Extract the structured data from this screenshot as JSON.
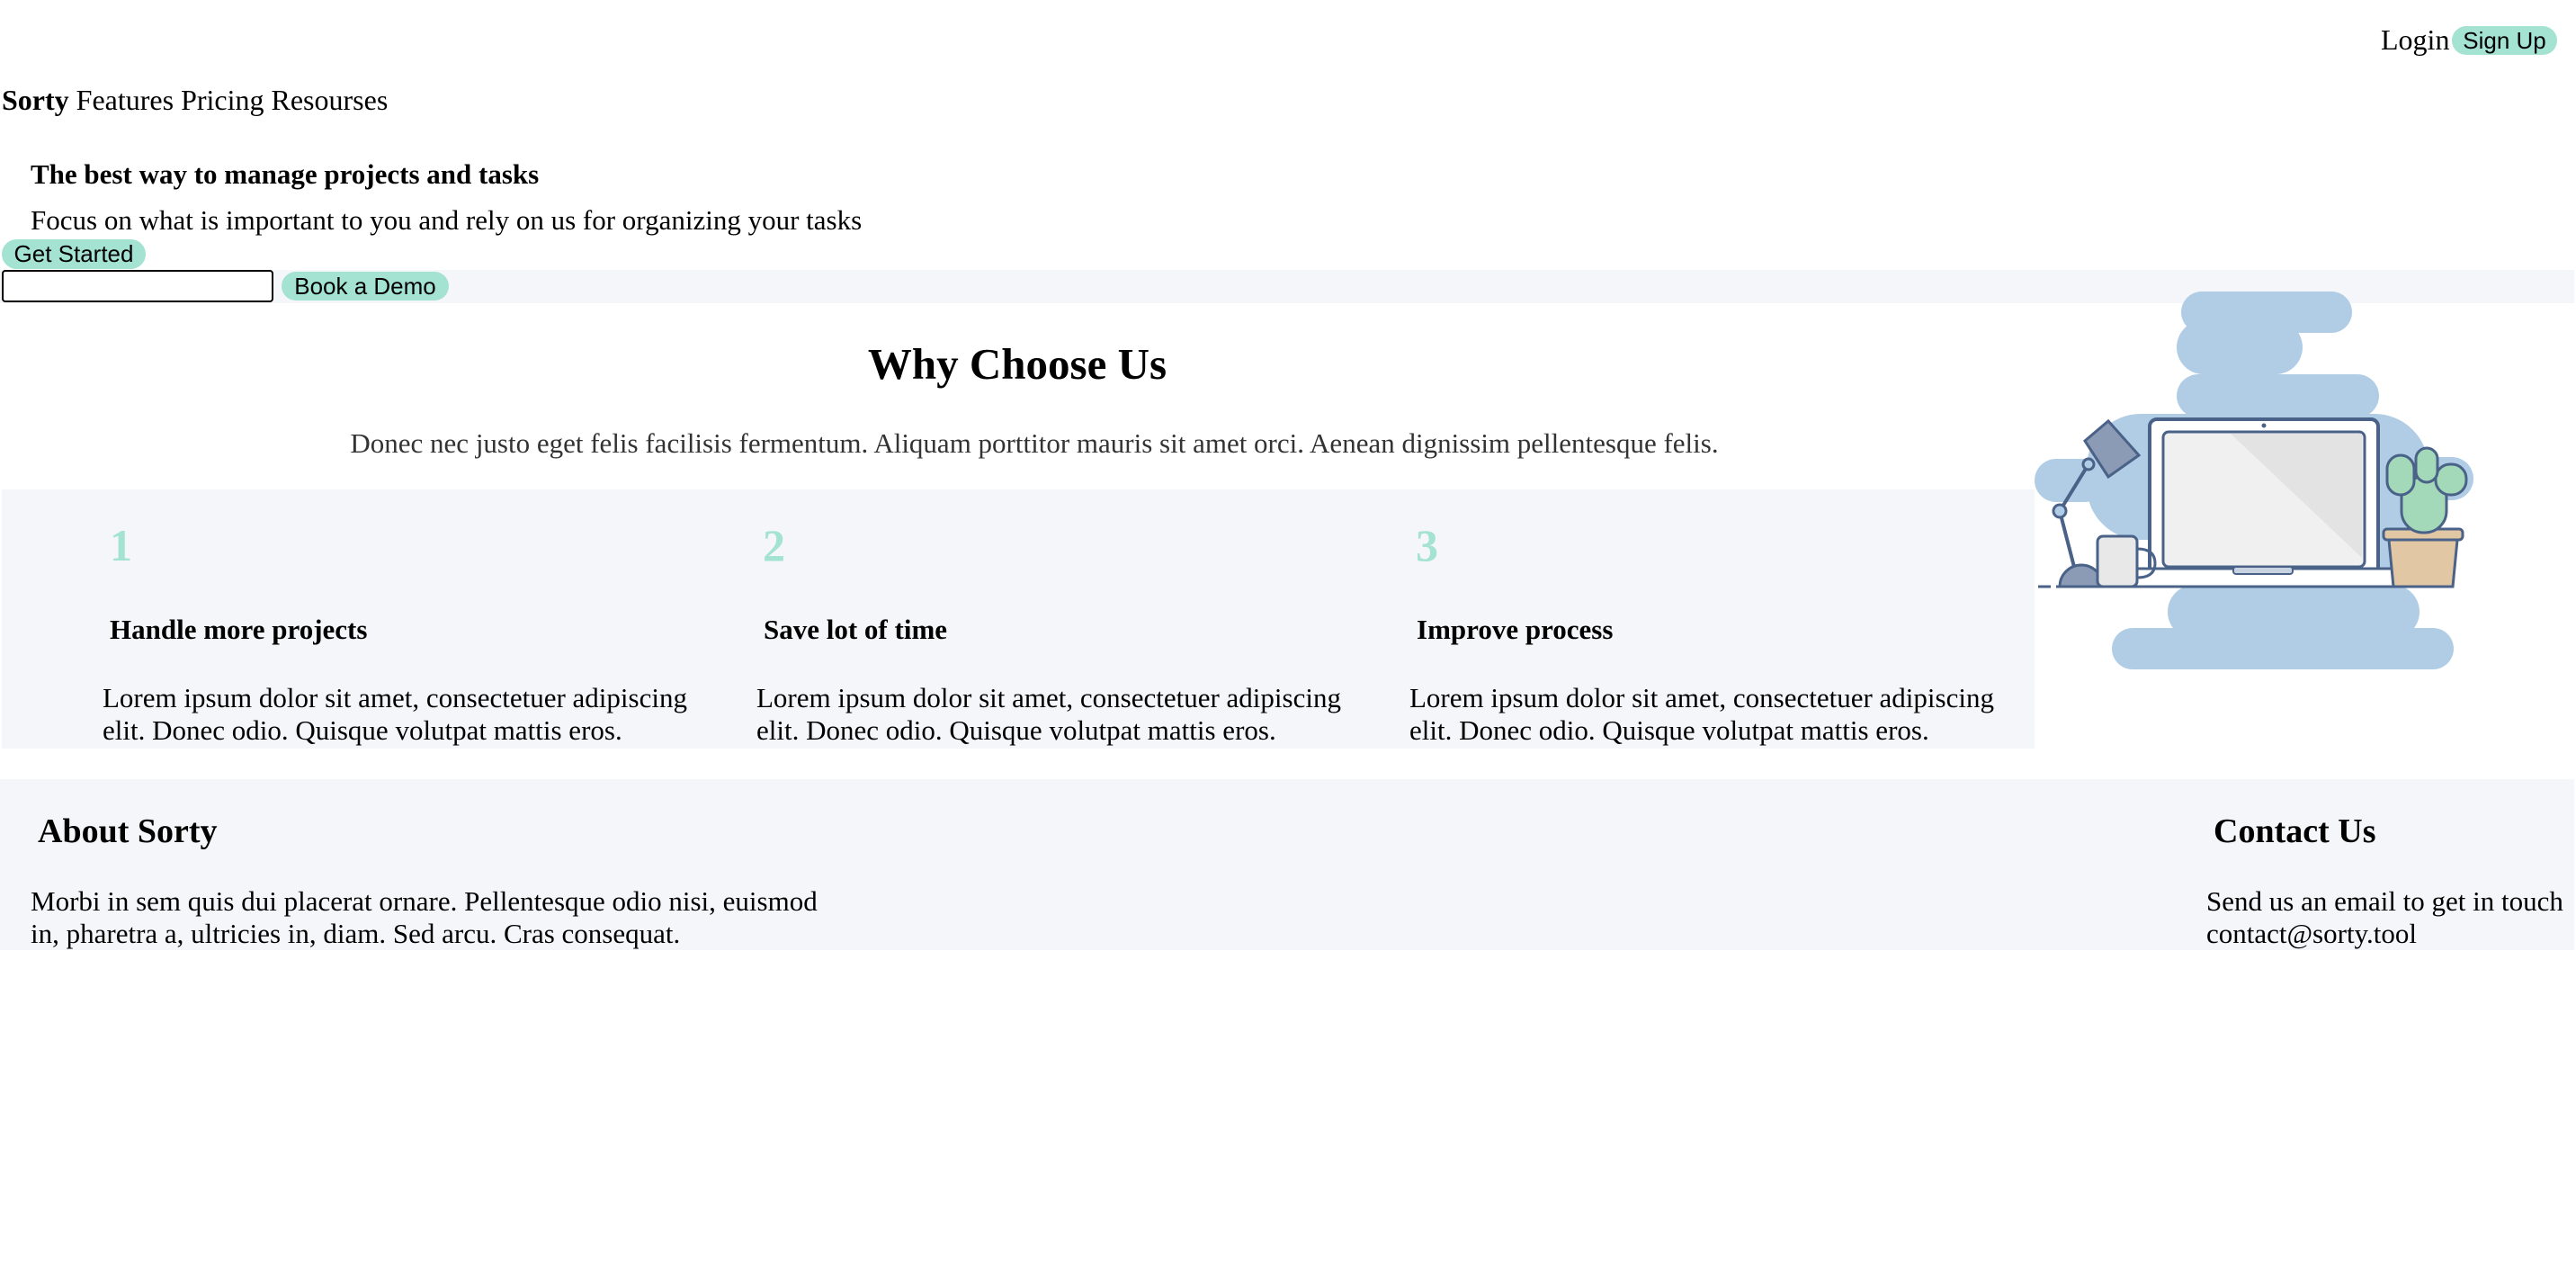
{
  "header": {
    "login_label": "Login",
    "signup_label": "Sign Up"
  },
  "nav": {
    "brand": "Sorty",
    "items": [
      "Features",
      "Pricing",
      "Resourses"
    ]
  },
  "hero": {
    "title": "The best way to manage projects and tasks",
    "subtitle": "Focus on what is important to you and rely on us for organizing your tasks",
    "get_started_label": "Get Started",
    "email_value": "",
    "book_demo_label": "Book a Demo"
  },
  "why": {
    "title": "Why Choose Us",
    "description": "Donec nec justo eget felis facilisis fermentum. Aliquam porttitor mauris sit amet orci. Aenean dignissim pellentesque felis.",
    "features": [
      {
        "number": "1",
        "title": "Handle more projects",
        "text": "Lorem ipsum dolor sit amet, consectetuer adipiscing elit. Donec odio. Quisque volutpat mattis eros."
      },
      {
        "number": "2",
        "title": "Save lot of time",
        "text": "Lorem ipsum dolor sit amet, consectetuer adipiscing elit. Donec odio. Quisque volutpat mattis eros."
      },
      {
        "number": "3",
        "title": "Improve process",
        "text": "Lorem ipsum dolor sit amet, consectetuer adipiscing elit. Donec odio. Quisque volutpat mattis eros."
      }
    ]
  },
  "footer": {
    "about_title": "About Sorty",
    "about_text": "Morbi in sem quis dui placerat ornare. Pellentesque odio nisi, euismod in, pharetra a, ultricies in, diam. Sed arcu. Cras consequat.",
    "contact_title": "Contact Us",
    "contact_line1": "Send us an email to get in touch",
    "contact_email": "contact@sorty.tool"
  },
  "colors": {
    "accent": "#a4e3d1",
    "band_bg": "#f5f6f9",
    "illustration_blob": "#b1cde6"
  },
  "illustration": "desk-laptop-illustration"
}
